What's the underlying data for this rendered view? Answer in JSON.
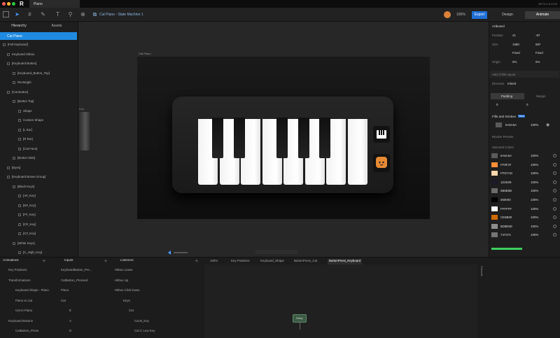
{
  "window": {
    "tab": "Piano",
    "version": "BETA 0.8.2199"
  },
  "toolbar": {
    "title": "Cat Piano - State Machine 1",
    "zoom": "100%",
    "export": "Export"
  },
  "right_tabs": {
    "design": "Design",
    "animate": "Animate"
  },
  "left_tabs": {
    "hierarchy": "Hierarchy",
    "assets": "Assets"
  },
  "hierarchy": {
    "selected": "Cat Piano",
    "rows": [
      "[Full keyboard]",
      "Keyboard Hitbox",
      "[Keyboard Button]",
      "[Keyboard_Button_Top]",
      "Rectangle",
      "[Cat Button]",
      "[Button Top]",
      "Shape",
      "Custom Shape",
      "[L Ear]",
      "[R Ear]",
      "[Cat Face]",
      "[Button Side]",
      "[Eyes]",
      "[Keyboard Bones Group]",
      "[Black Keys]",
      "[A#_Key]",
      "[D#_Key]",
      "[F#_Key]",
      "[G#_Key]",
      "[C#_Key]",
      "[White Keys]",
      "[C_High_Key]"
    ]
  },
  "canvas": {
    "artboard_label": "Cat Piano",
    "side_label": "Key"
  },
  "inspector": {
    "artboard": "Artboard",
    "position_label": "Position",
    "x": "41",
    "y": "-97",
    "size_label": "Size",
    "w": "1080",
    "h": "597",
    "fixed1": "Fixed",
    "fixed2": "Fixed",
    "origin_label": "Origin",
    "ox": "0%",
    "oy": "0%",
    "add_layout": "Add Child Layout",
    "direction_label": "Direction",
    "direction": "Inherit",
    "padding": "Padding",
    "margin": "Margin",
    "pad1": "0",
    "pad2": "0",
    "fills_label": "Fills and Strokes",
    "new_badge": "New",
    "fill_hex": "5A5A5A",
    "fill_pct": "100%",
    "render_presets": "Render Presets",
    "selected_colors": "Selected Colors",
    "colors": [
      {
        "hex": "5A5A5A",
        "pct": "100%",
        "swatch": "#5a5a5a"
      },
      {
        "hex": "FF8F37",
        "pct": "100%",
        "swatch": "#ff8f37"
      },
      {
        "hex": "FFD7AD",
        "pct": "100%",
        "swatch": "#ffd7ad"
      },
      {
        "hex": "1D1929",
        "pct": "100%",
        "swatch": "#1d1929"
      },
      {
        "hex": "6B6B6B",
        "pct": "100%",
        "swatch": "#6b6b6b"
      },
      {
        "hex": "000000",
        "pct": "100%",
        "swatch": "#000000"
      },
      {
        "hex": "FFFFFF",
        "pct": "100%",
        "swatch": "#ffffff"
      },
      {
        "hex": "CE6B00",
        "pct": "100%",
        "swatch": "#ce6b00"
      },
      {
        "hex": "8D8D8D",
        "pct": "100%",
        "swatch": "#8d8d8d"
      },
      {
        "hex": "747474",
        "pct": "100%",
        "swatch": "#747474"
      }
    ]
  },
  "bottom": {
    "animations": "Animations",
    "anim_rows": [
      "Key Positions",
      "Transformations",
      "Keyboard Shape - Piano",
      "Piano to Cat",
      "Cat to Piano",
      "Keyboard Buttons",
      "CatButton_Press"
    ],
    "inputs": "Inputs",
    "input_rows": [
      "KeyboardButton_Pre...",
      "CatButton_Pressed",
      "Piano",
      "Cat",
      "E",
      "A",
      "D"
    ],
    "listeners": "Listeners",
    "listener_rows": [
      "Hitbox Leave",
      "Hitbox Up",
      "Hitbox Click Down",
      "Keys",
      "Cat",
      "Cat B_Key",
      "Cat C Low Key"
    ],
    "graph_zoom": "100%",
    "graph_tabs": [
      "Key Positions",
      "Keyboard_Shape",
      "ButtonPress_Cat",
      "ButtonPress_Keyboard"
    ],
    "entry": "Entry",
    "side_label": "Console"
  }
}
